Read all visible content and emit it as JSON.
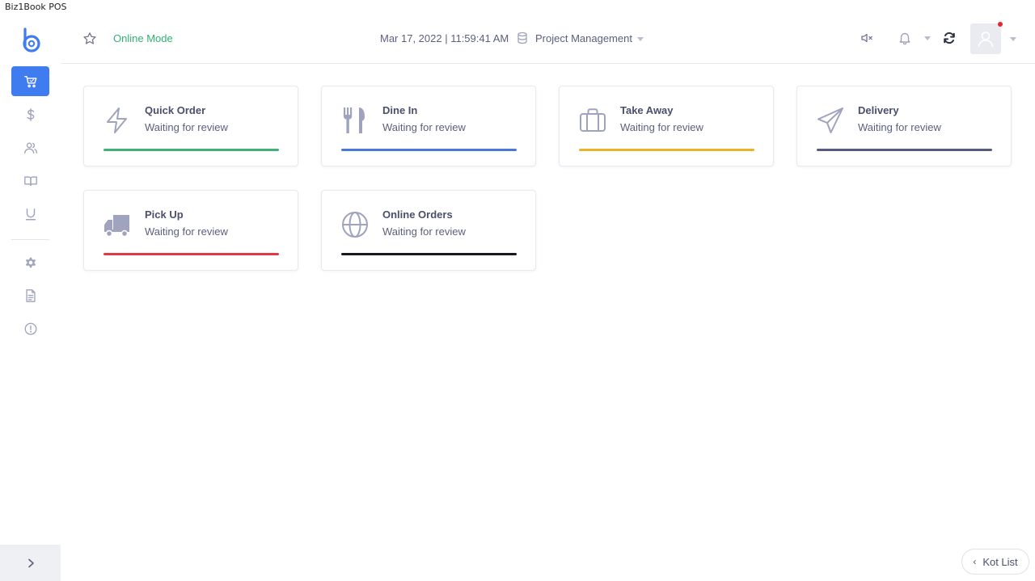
{
  "window": {
    "title": "Biz1Book POS"
  },
  "header": {
    "mode_label": "Online Mode",
    "datetime": "Mar 17, 2022 | 11:59:41 AM",
    "project": "Project Management"
  },
  "sidebar": {
    "items": [
      {
        "name": "cart-icon",
        "active": true
      },
      {
        "name": "dollar-icon",
        "active": false
      },
      {
        "name": "users-icon",
        "active": false
      },
      {
        "name": "book-icon",
        "active": false
      },
      {
        "name": "underline-icon",
        "active": false
      },
      {
        "name": "gear-icon",
        "active": false
      },
      {
        "name": "document-icon",
        "active": false
      },
      {
        "name": "alert-icon",
        "active": false
      }
    ],
    "expand_icon": "chevron-right-icon"
  },
  "cards": [
    {
      "title": "Quick Order",
      "subtitle": "Waiting for review",
      "icon": "lightning-icon",
      "color": "#3db37a"
    },
    {
      "title": "Dine In",
      "subtitle": "Waiting for review",
      "icon": "utensils-icon",
      "color": "#4a78d8"
    },
    {
      "title": "Take Away",
      "subtitle": "Waiting for review",
      "icon": "briefcase-icon",
      "color": "#eab32a"
    },
    {
      "title": "Delivery",
      "subtitle": "Waiting for review",
      "icon": "paper-plane-icon",
      "color": "#545a80"
    },
    {
      "title": "Pick Up",
      "subtitle": "Waiting for review",
      "icon": "truck-icon",
      "color": "#e23843"
    },
    {
      "title": "Online Orders",
      "subtitle": "Waiting for review",
      "icon": "globe-icon",
      "color": "#16171f"
    }
  ],
  "footer": {
    "kot_label": "Kot List"
  },
  "colors": {
    "accent": "#3f7cf0",
    "online": "#2fb36f",
    "notification_dot": "#e8262d",
    "icon": "#9fa3bd"
  }
}
